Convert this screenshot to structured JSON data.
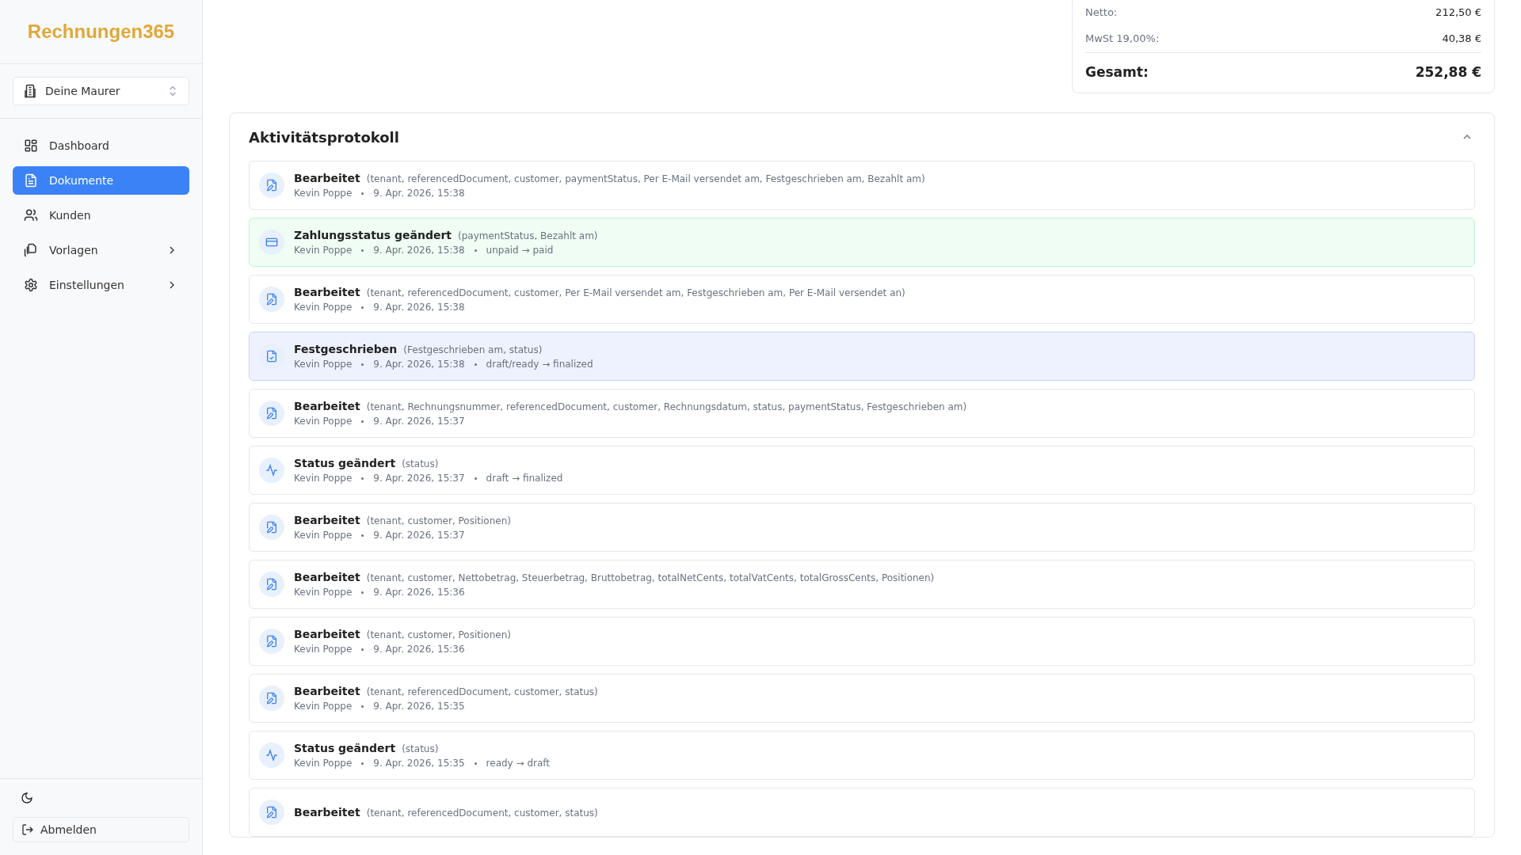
{
  "sidebar": {
    "logo": "Rechnungen365",
    "tenant_select": {
      "value": "Deine Maurer"
    },
    "items": [
      {
        "label": "Dashboard",
        "selected": false,
        "has_children": false
      },
      {
        "label": "Dokumente",
        "selected": true,
        "has_children": false
      },
      {
        "label": "Kunden",
        "selected": false,
        "has_children": false
      },
      {
        "label": "Vorlagen",
        "selected": false,
        "has_children": true
      },
      {
        "label": "Einstellungen",
        "selected": false,
        "has_children": true
      }
    ],
    "logout_button": "Abmelden"
  },
  "summary": {
    "rows": [
      {
        "label": "Netto:",
        "value": "212,50 €"
      },
      {
        "label": "MwSt 19,00%:",
        "value": "40,38 €"
      }
    ],
    "total": {
      "label": "Gesamt:",
      "value": "252,88 €"
    }
  },
  "activity_log": {
    "title": "Aktivitätsprotokoll",
    "expanded": true,
    "entries": [
      {
        "kind": "edit",
        "title": "Bearbeitet",
        "details": "(tenant, referencedDocument, customer, paymentStatus, Per E-Mail versendet am, Festgeschrieben am, Bezahlt am)",
        "author": "Kevin Poppe",
        "time": "9. Apr. 2026, 15:38"
      },
      {
        "kind": "payment",
        "title": "Zahlungsstatus geändert",
        "details": "(paymentStatus, Bezahlt am)",
        "author": "Kevin Poppe",
        "time": "9. Apr. 2026, 15:38",
        "change": "unpaid → paid"
      },
      {
        "kind": "edit",
        "title": "Bearbeitet",
        "details": "(tenant, referencedDocument, customer, Per E-Mail versendet am, Festgeschrieben am, Per E-Mail versendet an)",
        "author": "Kevin Poppe",
        "time": "9. Apr. 2026, 15:38"
      },
      {
        "kind": "finalize",
        "title": "Festgeschrieben",
        "details": "(Festgeschrieben am, status)",
        "author": "Kevin Poppe",
        "time": "9. Apr. 2026, 15:38",
        "change": "draft/ready → finalized"
      },
      {
        "kind": "edit",
        "title": "Bearbeitet",
        "details": "(tenant, Rechnungsnummer, referencedDocument, customer, Rechnungsdatum, status, paymentStatus, Festgeschrieben am)",
        "author": "Kevin Poppe",
        "time": "9. Apr. 2026, 15:37"
      },
      {
        "kind": "status",
        "title": "Status geändert",
        "details": "(status)",
        "author": "Kevin Poppe",
        "time": "9. Apr. 2026, 15:37",
        "change": "draft → finalized"
      },
      {
        "kind": "edit",
        "title": "Bearbeitet",
        "details": "(tenant, customer, Positionen)",
        "author": "Kevin Poppe",
        "time": "9. Apr. 2026, 15:37"
      },
      {
        "kind": "edit",
        "title": "Bearbeitet",
        "details": "(tenant, customer, Nettobetrag, Steuerbetrag, Bruttobetrag, totalNetCents, totalVatCents, totalGrossCents, Positionen)",
        "author": "Kevin Poppe",
        "time": "9. Apr. 2026, 15:36"
      },
      {
        "kind": "edit",
        "title": "Bearbeitet",
        "details": "(tenant, customer, Positionen)",
        "author": "Kevin Poppe",
        "time": "9. Apr. 2026, 15:36"
      },
      {
        "kind": "edit",
        "title": "Bearbeitet",
        "details": "(tenant, referencedDocument, customer, status)",
        "author": "Kevin Poppe",
        "time": "9. Apr. 2026, 15:35"
      },
      {
        "kind": "status",
        "title": "Status geändert",
        "details": "(status)",
        "author": "Kevin Poppe",
        "time": "9. Apr. 2026, 15:35",
        "change": "ready → draft"
      },
      {
        "kind": "edit",
        "title": "Bearbeitet",
        "details": "(tenant, referencedDocument, customer, status)"
      }
    ]
  }
}
